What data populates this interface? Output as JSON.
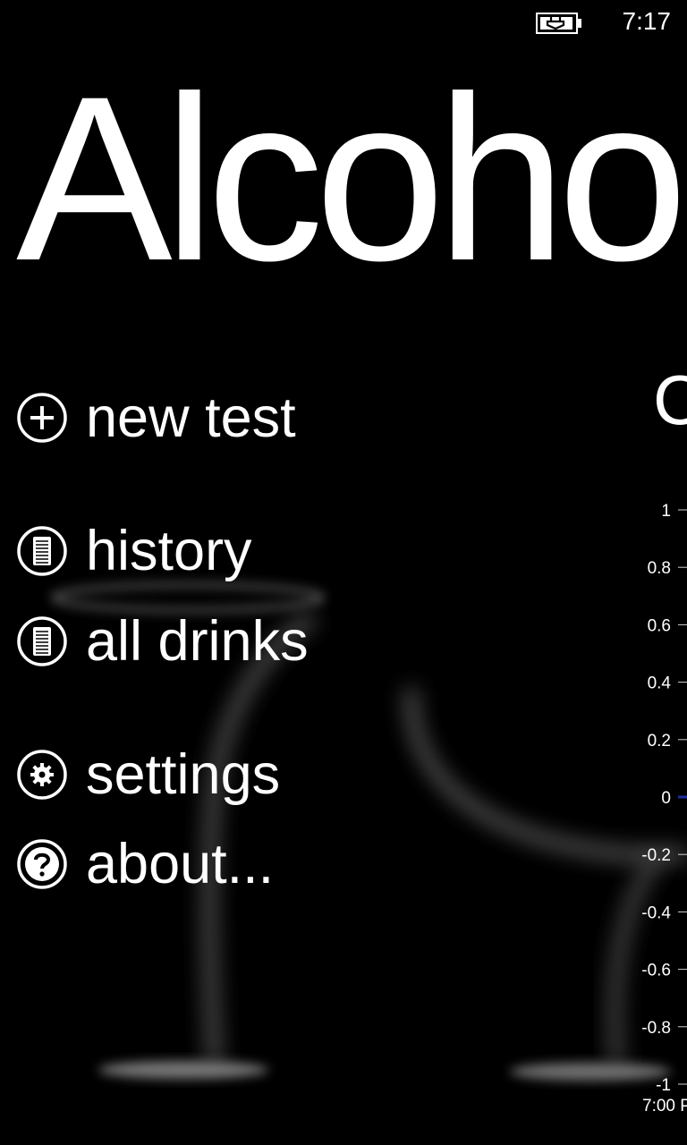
{
  "status": {
    "time": "7:17",
    "battery_icon": "battery-charging-icon"
  },
  "app": {
    "title": "Alcoho"
  },
  "menu": {
    "items": [
      {
        "label": "new test",
        "icon": "plus-circle-icon"
      },
      {
        "label": "history",
        "icon": "list-circle-icon"
      },
      {
        "label": "all drinks",
        "icon": "list-circle-icon"
      },
      {
        "label": "settings",
        "icon": "gear-circle-icon"
      },
      {
        "label": "about...",
        "icon": "question-circle-icon"
      }
    ]
  },
  "section": {
    "heading": "C"
  },
  "chart_data": {
    "type": "line",
    "ylim": [
      -1,
      1
    ],
    "yticks": [
      "1",
      "0.8",
      "0.6",
      "0.4",
      "0.2",
      "0",
      "-0.2",
      "-0.4",
      "-0.6",
      "-0.8",
      "-1"
    ],
    "xticks": [
      "7:00 P"
    ],
    "series": [
      {
        "color": "#1e2ea0",
        "values": [
          0
        ]
      }
    ]
  },
  "colors": {
    "background": "#000000",
    "text": "#ffffff",
    "series": "#1e2ea0"
  }
}
